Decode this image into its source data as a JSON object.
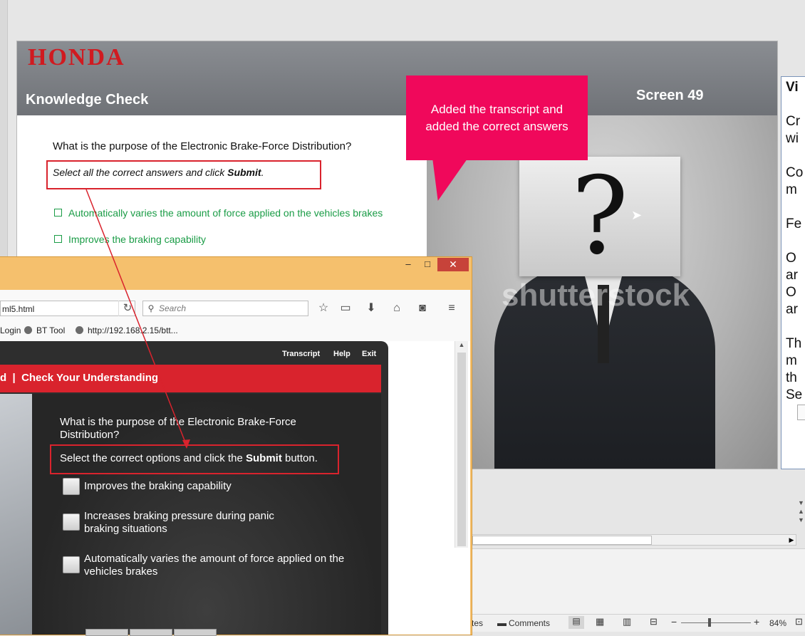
{
  "slide": {
    "logo": "HONDA",
    "title": "Knowledge Check",
    "screen": "Screen 49",
    "question": "What is the purpose of the Electronic Brake-Force Distribution?",
    "instruction_prefix": "Select all the correct answers and click ",
    "instruction_bold": "Submit",
    "instruction_suffix": ".",
    "answers": [
      "Automatically varies the amount of force applied on the vehicles brakes",
      "Improves the braking capability"
    ],
    "watermark": "shutterstock"
  },
  "callout": {
    "line1": "Added the transcript and",
    "line2": "added the correct answers",
    "color": "#f0085b"
  },
  "right_panel": {
    "lines": [
      "Vi",
      "Cr",
      "wi",
      "Co",
      "m",
      "Fe",
      "O",
      "ar",
      "O",
      "ar",
      "Th",
      "m",
      "th",
      "Se"
    ]
  },
  "status": {
    "notes_label": "tes",
    "comments_label": "Comments",
    "zoom": "84%"
  },
  "browser": {
    "url": "ml5.html",
    "search_placeholder": "Search",
    "bookmarks": [
      "Login",
      "BT Tool",
      "http://192.168.2.15/btt..."
    ]
  },
  "course": {
    "links": [
      "Transcript",
      "Help",
      "Exit"
    ],
    "header_prefix": "d",
    "header_sep": "|",
    "header": "Check Your Understanding",
    "question": "What is the purpose of the Electronic Brake-Force Distribution?",
    "instruction_prefix": "Select the correct options and click the ",
    "instruction_bold": "Submit",
    "instruction_suffix": " button.",
    "options": [
      {
        "line1": "Improves the braking capability",
        "line2": ""
      },
      {
        "line1": "Increases braking pressure during panic",
        "line2": "braking situations"
      },
      {
        "line1": "Automatically varies the amount of force applied on the",
        "line2": "vehicles brakes"
      }
    ]
  },
  "colors": {
    "honda_red": "#d01a20",
    "answer_green": "#1a9c46",
    "annotation_red": "#d9232d",
    "window_frame": "#f5c06d"
  }
}
